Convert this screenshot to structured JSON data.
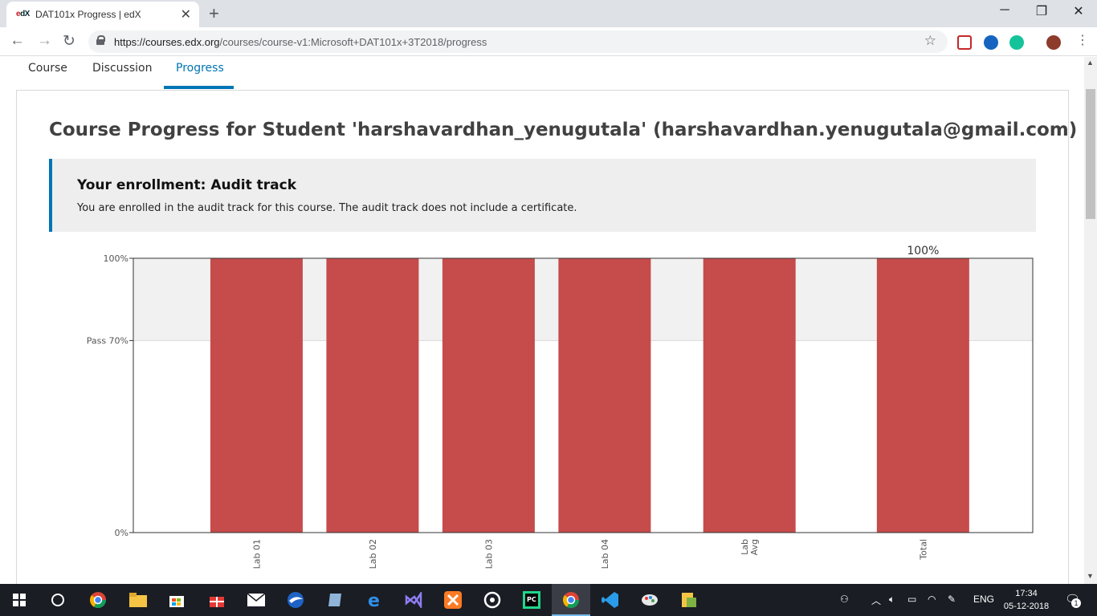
{
  "browser": {
    "tab_title": "DAT101x Progress | edX",
    "favicon_text_a": "e",
    "favicon_text_b": "dX",
    "new_tab": "+",
    "close_tab": "✕",
    "url_host": "https://courses.edx.org",
    "url_path": "/courses/course-v1:Microsoft+DAT101x+3T2018/progress",
    "window_controls": {
      "minimize": "─",
      "restore": "❐",
      "close": "✕"
    }
  },
  "course_nav": {
    "items": [
      {
        "label": "Course",
        "active": false
      },
      {
        "label": "Discussion",
        "active": false
      },
      {
        "label": "Progress",
        "active": true
      }
    ]
  },
  "progress": {
    "title": "Course Progress for Student 'harshavardhan_yenugutala' (harshavardhan.yenugutala@gmail.com)",
    "enrollment_heading": "Your enrollment: Audit track",
    "enrollment_text": "You are enrolled in the audit track for this course. The audit track does not include a certificate."
  },
  "chart_data": {
    "type": "bar",
    "categories": [
      "Lab 01",
      "Lab 02",
      "Lab 03",
      "Lab 04",
      "Lab Avg",
      "Total"
    ],
    "values": [
      100,
      100,
      100,
      100,
      100,
      100
    ],
    "ylim": [
      0,
      100
    ],
    "y_ticks": [
      {
        "value": 100,
        "label": "100%"
      },
      {
        "value": 70,
        "label": "Pass 70%"
      },
      {
        "value": 0,
        "label": "0%"
      }
    ],
    "pass_threshold": 70,
    "total_label": "100%",
    "bar_color": "#c64b4b",
    "pass_band_color": "#f1f1f1"
  },
  "taskbar": {
    "language": "ENG",
    "time": "17:34",
    "date": "05-12-2018",
    "notification_count": "1"
  },
  "colors": {
    "accent": "#0075b4",
    "bar": "#c64b4b"
  }
}
